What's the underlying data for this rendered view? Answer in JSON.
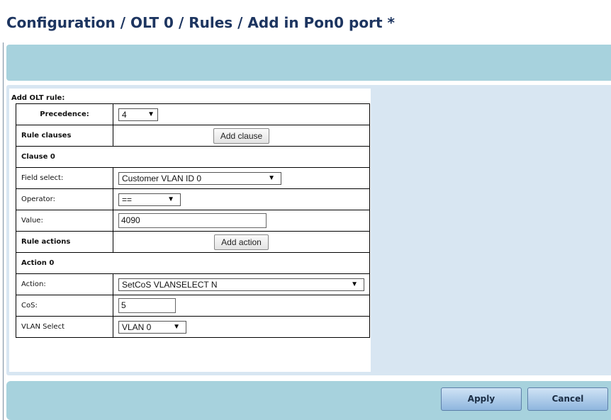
{
  "page": {
    "title": "Configuration / OLT 0 / Rules / Add in Pon0 port *"
  },
  "form": {
    "caption": "Add OLT rule:",
    "precedence": {
      "label": "Precedence:",
      "value": "4"
    },
    "rule_clauses": {
      "label": "Rule clauses",
      "button": "Add clause"
    },
    "clause": {
      "header": "Clause 0",
      "field_select": {
        "label": "Field select:",
        "value": "Customer VLAN ID 0"
      },
      "operator": {
        "label": "Operator:",
        "value": "=="
      },
      "value": {
        "label": "Value:",
        "value": "4090"
      }
    },
    "rule_actions": {
      "label": "Rule actions",
      "button": "Add action"
    },
    "action": {
      "header": "Action 0",
      "action_field": {
        "label": "Action:",
        "value": "SetCoS VLANSELECT N"
      },
      "cos": {
        "label": "CoS:",
        "value": "5"
      },
      "vlan_select": {
        "label": "VLAN Select",
        "value": "VLAN 0"
      }
    }
  },
  "footer": {
    "apply_label": "Apply",
    "cancel_label": "Cancel"
  },
  "icons": {
    "dropdown_glyph": "▼"
  },
  "colors": {
    "title": "#1d3560",
    "band": "#a7d2dd",
    "panel": "#d8e6f2",
    "button_gradient_top": "#cfe3f5",
    "button_gradient_bottom": "#8fb6de"
  }
}
